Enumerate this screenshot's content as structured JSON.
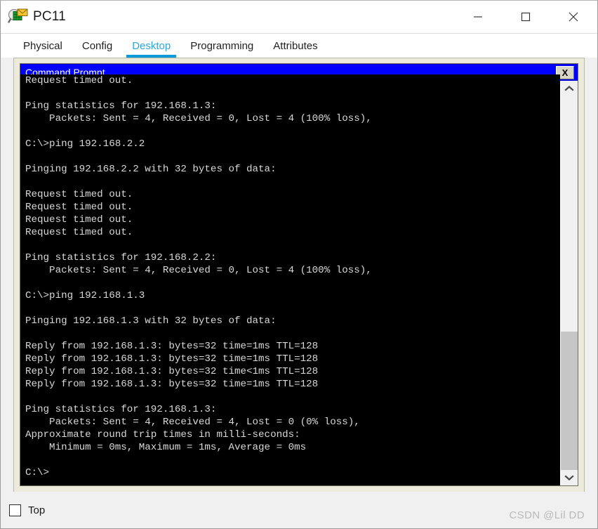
{
  "window": {
    "title": "PC11",
    "icon": "pc-magnifier-envelope-icon",
    "controls": {
      "minimize_label": "─",
      "maximize_label": "☐",
      "close_label": "✕"
    }
  },
  "tabs": [
    {
      "label": "Physical",
      "active": false
    },
    {
      "label": "Config",
      "active": false
    },
    {
      "label": "Desktop",
      "active": true
    },
    {
      "label": "Programming",
      "active": false
    },
    {
      "label": "Attributes",
      "active": false
    }
  ],
  "command_prompt": {
    "title": "Command Prompt",
    "close_label": "X",
    "terminal_text": "Request timed out.\n\nPing statistics for 192.168.1.3:\n    Packets: Sent = 4, Received = 0, Lost = 4 (100% loss),\n\nC:\\>ping 192.168.2.2\n\nPinging 192.168.2.2 with 32 bytes of data:\n\nRequest timed out.\nRequest timed out.\nRequest timed out.\nRequest timed out.\n\nPing statistics for 192.168.2.2:\n    Packets: Sent = 4, Received = 0, Lost = 4 (100% loss),\n\nC:\\>ping 192.168.1.3\n\nPinging 192.168.1.3 with 32 bytes of data:\n\nReply from 192.168.1.3: bytes=32 time=1ms TTL=128\nReply from 192.168.1.3: bytes=32 time=1ms TTL=128\nReply from 192.168.1.3: bytes=32 time<1ms TTL=128\nReply from 192.168.1.3: bytes=32 time=1ms TTL=128\n\nPing statistics for 192.168.1.3:\n    Packets: Sent = 4, Received = 4, Lost = 0 (0% loss),\nApproximate round trip times in milli-seconds:\n    Minimum = 0ms, Maximum = 1ms, Average = 0ms\n\nC:\\>",
    "scrollbar": {
      "up_arrow": "⌃",
      "down_arrow": "⌄",
      "thumb_position_percent": 63
    }
  },
  "bottom_bar": {
    "top_checkbox_label": "Top",
    "top_checkbox_checked": false
  },
  "watermark": "CSDN @Lil DD",
  "colors": {
    "accent_tab": "#29a7dd",
    "tab_underline": "#0e9ad8",
    "cmd_titlebar": "#0000ff",
    "panel_background": "#eceadb",
    "terminal_background": "#000000",
    "terminal_text": "#d8d8d8"
  }
}
